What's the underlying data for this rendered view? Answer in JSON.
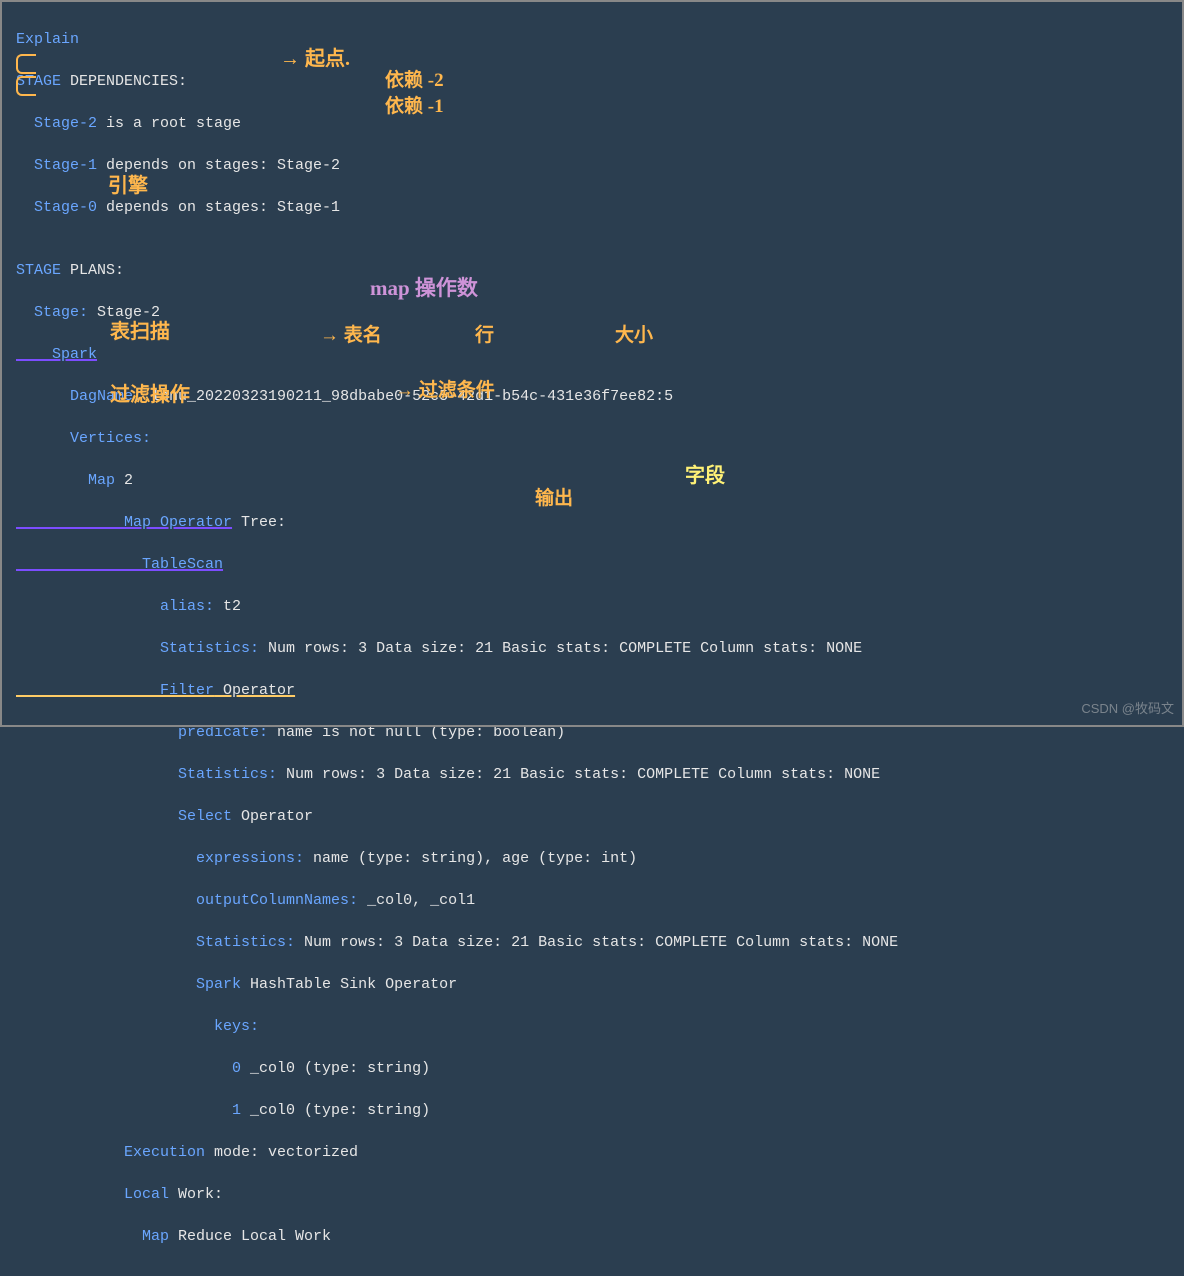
{
  "code": {
    "l1": "Explain",
    "l2a": "STAGE",
    "l2b": " DEPENDENCIES:",
    "l3a": "  Stage-2",
    "l3b": " is a root stage",
    "l4a": "  Stage-1",
    "l4b": " depends on stages: Stage-2",
    "l5a": "  Stage-0",
    "l5b": " depends on stages: Stage-1",
    "l6": "",
    "l7a": "STAGE",
    "l7b": " PLANS:",
    "l8a": "  Stage:",
    "l8b": " Stage-2",
    "l9": "    Spark",
    "l10a": "      DagName:",
    "l10b": " lnnu_20220323190211_98dbabe0-52c5-42d1-b54c-431e36f7ee82:5",
    "l11": "      Vertices:",
    "l12a": "        Map",
    "l12b": " 2",
    "l13a": "            Map Operator",
    "l13b": " Tree:",
    "l14": "              TableScan",
    "l15a": "                alias:",
    "l15b": " t2",
    "l16a": "                Statistics:",
    "l16b": " Num rows: 3 Data size: 21 Basic stats: COMPLETE Column stats: NONE",
    "l17a": "                Filter",
    "l17b": " Operator",
    "l18a": "                  predicate:",
    "l18b": " name is not null (type: boolean)",
    "l19a": "                  Statistics:",
    "l19b": " Num rows: 3 Data size: 21 Basic stats: COMPLETE Column stats: NONE",
    "l20a": "                  Select",
    "l20b": " Operator",
    "l21a": "                    expressions:",
    "l21b": " name (type: string), age (type: int)",
    "l22a": "                    outputColumnNames:",
    "l22b": " _col0, _col1",
    "l23a": "                    Statistics:",
    "l23b": " Num rows: 3 Data size: 21 Basic stats: COMPLETE Column stats: NONE",
    "l24a": "                    Spark",
    "l24b": " HashTable Sink Operator",
    "l25": "                      keys:",
    "l26a": "                        0",
    "l26b": " _col0 (type: string)",
    "l27a": "                        1",
    "l27b": " _col0 (type: string)",
    "l28a": "            Execution",
    "l28b": " mode: vectorized",
    "l29a": "            Local",
    "l29b": " Work:",
    "l30a": "              Map",
    "l30b": " Reduce Local Work"
  },
  "annotations": {
    "a_arrow1": "→",
    "a_start": "起点.",
    "a_dep1": "依赖 -2",
    "a_dep2": "依赖 -1",
    "a_engine": "引擎",
    "a_maptree": "map 操作数",
    "a_tablescan": "表扫描",
    "a_tablename_arrow": "→ 表名",
    "a_row": "行",
    "a_size": "大小",
    "a_filterop": "过滤操作",
    "a_filtercond_arrow": "→ 过滤条件",
    "a_field": "字段",
    "a_output": "输出"
  },
  "watermark": "CSDN @牧码文"
}
